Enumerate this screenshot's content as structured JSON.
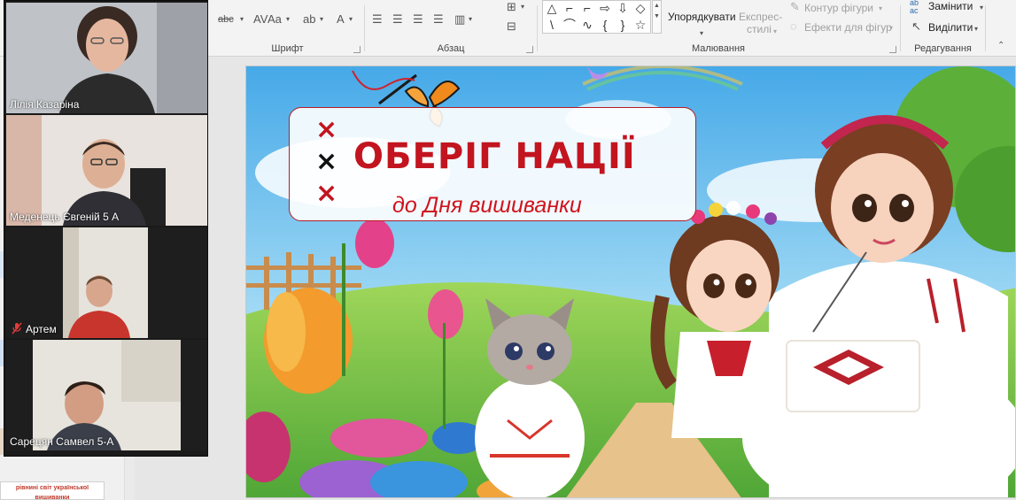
{
  "ribbon": {
    "font_group_label": "Шрифт",
    "paragraph_group_label": "Абзац",
    "drawing_group_label": "Малювання",
    "editing_group_label": "Редагування",
    "font_case_label": "Aa",
    "font_color_label": "A",
    "arrange_label": "Упорядкувати",
    "quick_styles_label_line1": "Експрес-",
    "quick_styles_label_line2": "стилі",
    "shape_outline_label": "Контур фігури",
    "shape_effects_label": "Ефекти для фігур",
    "replace_label": "Замінити",
    "select_label": "Виділити",
    "replace_icon_text": "ab\nac"
  },
  "participants": [
    {
      "name": "Лілія Казаріна",
      "muted": false,
      "active": true
    },
    {
      "name": "Меденець Євгеній 5 А",
      "muted": false,
      "active": false
    },
    {
      "name": "Артем",
      "muted": true,
      "active": false
    },
    {
      "name": "Сарецян Самвел 5-А",
      "muted": false,
      "active": false
    }
  ],
  "thumbnail": {
    "caption_line1": "рівнині світ української",
    "caption_line2": "вишиванки"
  },
  "slide": {
    "title": "ОБЕРІГ НАЦІЇ",
    "subtitle": "до Дня вишиванки",
    "colors": {
      "accent": "#c2151f",
      "sky": "#7fc9f2",
      "meadow": "#6fbf3f"
    }
  },
  "icons": [
    "strikethrough-icon",
    "clear-formatting-icon",
    "align-left-icon",
    "align-center-icon",
    "align-right-icon",
    "justify-icon",
    "mic-muted-icon",
    "butterfly-icon",
    "needle-icon",
    "scroll-arrow-icon"
  ]
}
